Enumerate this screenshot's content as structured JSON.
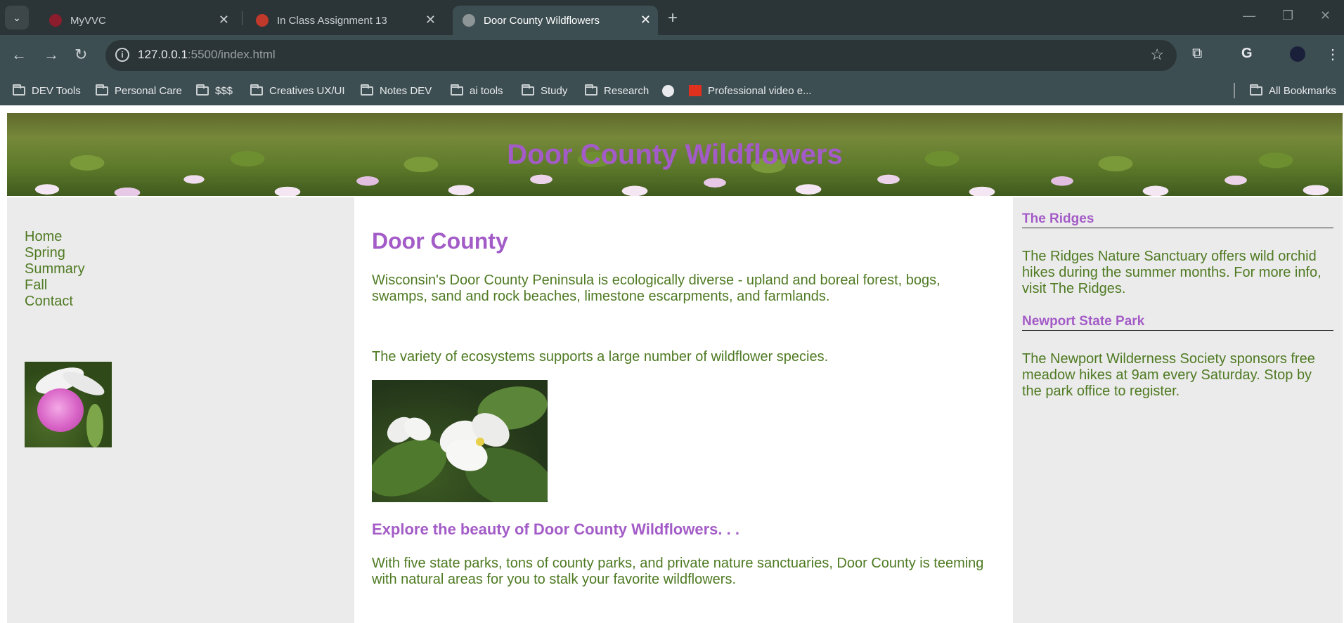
{
  "browser": {
    "tabs": [
      {
        "title": "MyVVC",
        "active": false
      },
      {
        "title": "In Class Assignment 13",
        "active": false
      },
      {
        "title": "Door County Wildflowers",
        "active": true
      }
    ],
    "url_host": "127.0.0.1",
    "url_rest": ":5500/index.html",
    "bookmarks": [
      "DEV Tools",
      "Personal Care",
      "$$$",
      "Creatives UX/UI",
      "Notes DEV",
      "ai tools",
      "Study",
      "Research",
      "Professional video e..."
    ],
    "all_bookmarks": "All Bookmarks"
  },
  "header": {
    "title": "Door County Wildflowers"
  },
  "nav": {
    "items": [
      "Home",
      "Spring",
      "Summary",
      "Fall",
      "Contact"
    ]
  },
  "main": {
    "heading": "Door County",
    "para1": "Wisconsin's Door County Peninsula is ecologically diverse - upland and boreal forest, bogs, swamps, sand and rock beaches, limestone escarpments, and farmlands.",
    "para2": "The variety of ecosystems supports a large number of wildflower species.",
    "subheading": "Explore the beauty of Door County Wildflowers. . .",
    "para3": "With five state parks, tons of county parks, and private nature sanctuaries, Door County is teeming with natural areas for you to stalk your favorite wildflowers."
  },
  "sidebar": {
    "sections": [
      {
        "title": "The Ridges",
        "text": "The Ridges Nature Sanctuary offers wild orchid hikes during the summer months. For more info, visit The Ridges."
      },
      {
        "title": "Newport State Park",
        "text": "The Newport Wilderness Society sponsors free meadow hikes at 9am every Saturday. Stop by the park office to register."
      }
    ]
  },
  "icons": [
    "tab-search-icon",
    "favicon-icon",
    "close-icon",
    "new-tab-icon",
    "back-icon",
    "forward-icon",
    "reload-icon",
    "site-info-icon",
    "bookmark-star-icon",
    "extensions-icon",
    "google-icon",
    "profile-icon",
    "menu-icon",
    "folder-icon",
    "globe-icon",
    "adobe-icon"
  ],
  "colors": {
    "heading": "#a35cc7",
    "text": "#4e7a22",
    "side_bg": "#ecebeb",
    "chrome_dark": "#2b3436",
    "chrome_light": "#3d4e52"
  }
}
